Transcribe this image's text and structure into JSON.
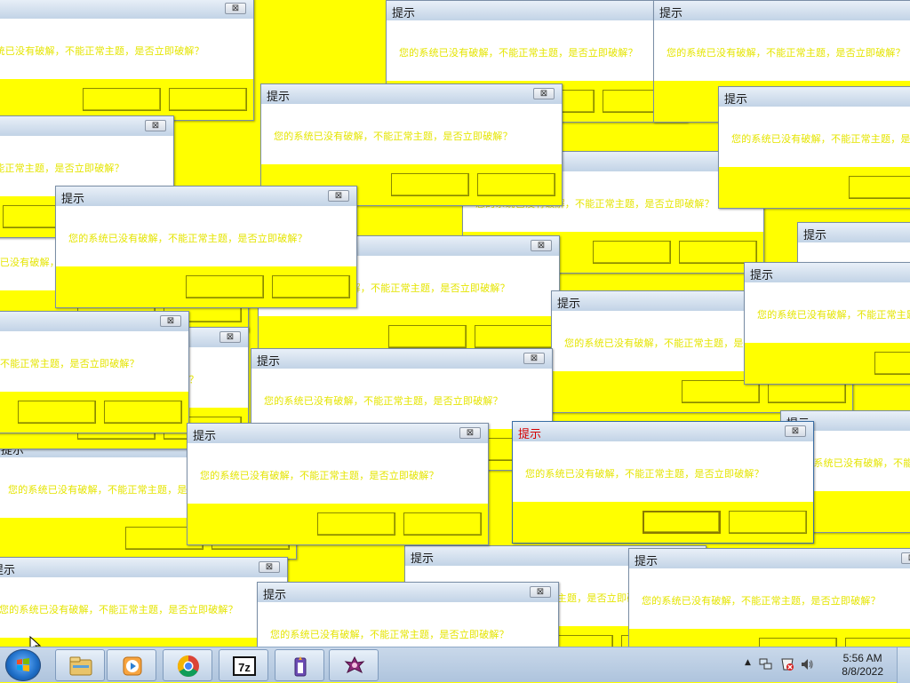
{
  "dialog": {
    "title": "提示",
    "message": "您的系统已没有破解，不能正常主题，是否立即破解？",
    "close_glyph": "⊠"
  },
  "colors": {
    "accent_yellow": "#ffff00",
    "message_yellow": "#e5e500",
    "active_title": "#d40000"
  },
  "taskbar": {
    "start_label": "Start",
    "items": [
      "explorer-icon",
      "media-player-icon",
      "chrome-icon",
      "7zip-icon",
      "app-icon",
      "app-icon-2"
    ],
    "sevenzip_label": "7z",
    "clock": {
      "time": "5:56 AM",
      "date": "8/8/2022"
    }
  }
}
